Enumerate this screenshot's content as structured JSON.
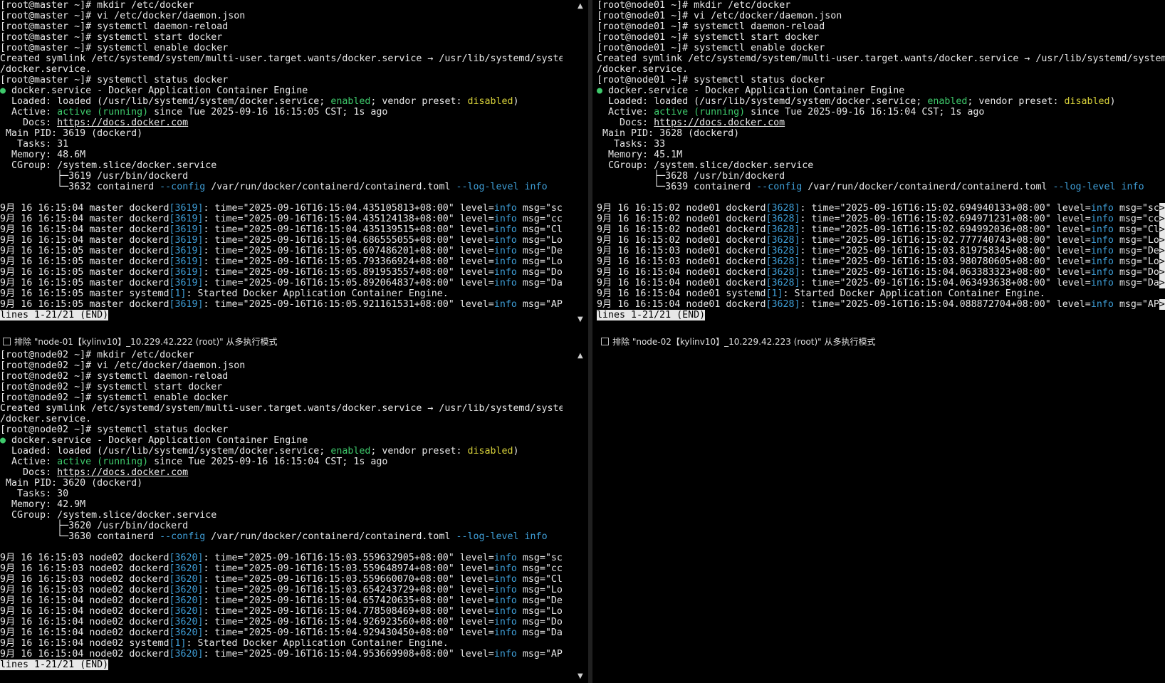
{
  "panes": [
    {
      "id": "master",
      "prompt": "[root@master ~]#",
      "cmds": [
        "mkdir /etc/docker",
        "vi /etc/docker/daemon.json",
        "systemctl daemon-reload",
        "systemctl start docker",
        "systemctl enable docker"
      ],
      "symlink1": "Created symlink /etc/systemd/system/multi-user.target.wants/docker.service → /usr/lib/systemd/system",
      "symlink2": "/docker.service.",
      "status_cmd": "systemctl status docker",
      "since": " since Tue 2025-09-16 16:15:05 CST; 1s ago",
      "pid": "3619 (dockerd)",
      "tasks": "31",
      "memory": "48.6M",
      "cg1": "3619 /usr/bin/dockerd",
      "cg2": "3632 containerd ",
      "log_pid": "[3619]",
      "host": "master",
      "logs": [
        [
          "9月 16 16:15:04",
          "2025-09-16T16:15:04.435105813+08:00",
          "sc"
        ],
        [
          "9月 16 16:15:04",
          "2025-09-16T16:15:04.435124138+08:00",
          "cc"
        ],
        [
          "9月 16 16:15:04",
          "2025-09-16T16:15:04.435139515+08:00",
          "Cl"
        ],
        [
          "9月 16 16:15:04",
          "2025-09-16T16:15:04.686555055+08:00",
          "Lo"
        ],
        [
          "9月 16 16:15:05",
          "2025-09-16T16:15:05.607486201+08:00",
          "De"
        ],
        [
          "9月 16 16:15:05",
          "2025-09-16T16:15:05.793366924+08:00",
          "Lo"
        ],
        [
          "9月 16 16:15:05",
          "2025-09-16T16:15:05.891953557+08:00",
          "Do"
        ],
        [
          "9月 16 16:15:05",
          "2025-09-16T16:15:05.892064837+08:00",
          "Da"
        ]
      ],
      "started_time": "9月 16 16:15:05",
      "last": [
        "9月 16 16:15:05",
        "2025-09-16T16:15:05.921161531+08:00",
        "AP"
      ],
      "exclude": "排除 \"node-01【kylinv10】_10.229.42.222 (root)\" 从多执行模式"
    },
    {
      "id": "node01",
      "prompt": "[root@node01 ~]#",
      "cmds": [
        "mkdir /etc/docker",
        "vi /etc/docker/daemon.json",
        "systemctl daemon-reload",
        "systemctl start docker",
        "systemctl enable docker"
      ],
      "symlink1": "Created symlink /etc/systemd/system/multi-user.target.wants/docker.service → /usr/lib/systemd/system",
      "symlink2": "/docker.service.",
      "status_cmd": "systemctl status docker",
      "since": " since Tue 2025-09-16 16:15:04 CST; 1s ago",
      "pid": "3628 (dockerd)",
      "tasks": "33",
      "memory": "45.1M",
      "cg1": "3628 /usr/bin/dockerd",
      "cg2": "3639 containerd ",
      "log_pid": "[3628]",
      "host": "node01",
      "logs": [
        [
          "9月 16 16:15:02",
          "2025-09-16T16:15:02.694940133+08:00",
          "sc"
        ],
        [
          "9月 16 16:15:02",
          "2025-09-16T16:15:02.694971231+08:00",
          "cc"
        ],
        [
          "9月 16 16:15:02",
          "2025-09-16T16:15:02.694992036+08:00",
          "Cl"
        ],
        [
          "9月 16 16:15:02",
          "2025-09-16T16:15:02.777740743+08:00",
          "Lo"
        ],
        [
          "9月 16 16:15:03",
          "2025-09-16T16:15:03.819758345+08:00",
          "De"
        ],
        [
          "9月 16 16:15:03",
          "2025-09-16T16:15:03.980780605+08:00",
          "Lo"
        ],
        [
          "9月 16 16:15:04",
          "2025-09-16T16:15:04.063383323+08:00",
          "Do"
        ],
        [
          "9月 16 16:15:04",
          "2025-09-16T16:15:04.063493638+08:00",
          "Da"
        ]
      ],
      "started_time": "9月 16 16:15:04",
      "last": [
        "9月 16 16:15:04",
        "2025-09-16T16:15:04.088872704+08:00",
        "AP"
      ],
      "exclude": "排除 \"node-02【kylinv10】_10.229.42.223 (root)\" 从多执行模式"
    },
    {
      "id": "node02",
      "prompt": "[root@node02 ~]#",
      "cmds": [
        "mkdir /etc/docker",
        "vi /etc/docker/daemon.json",
        "systemctl daemon-reload",
        "systemctl start docker",
        "systemctl enable docker"
      ],
      "symlink1": "Created symlink /etc/systemd/system/multi-user.target.wants/docker.service → /usr/lib/systemd/system",
      "symlink2": "/docker.service.",
      "status_cmd": "systemctl status docker",
      "since": " since Tue 2025-09-16 16:15:04 CST; 1s ago",
      "pid": "3620 (dockerd)",
      "tasks": "30",
      "memory": "42.9M",
      "cg1": "3620 /usr/bin/dockerd",
      "cg2": "3630 containerd ",
      "log_pid": "[3620]",
      "host": "node02",
      "logs": [
        [
          "9月 16 16:15:03",
          "2025-09-16T16:15:03.559632905+08:00",
          "sc"
        ],
        [
          "9月 16 16:15:03",
          "2025-09-16T16:15:03.559648974+08:00",
          "cc"
        ],
        [
          "9月 16 16:15:03",
          "2025-09-16T16:15:03.559660070+08:00",
          "Cl"
        ],
        [
          "9月 16 16:15:03",
          "2025-09-16T16:15:03.654243729+08:00",
          "Lo"
        ],
        [
          "9月 16 16:15:04",
          "2025-09-16T16:15:04.657420635+08:00",
          "De"
        ],
        [
          "9月 16 16:15:04",
          "2025-09-16T16:15:04.778508469+08:00",
          "Lo"
        ],
        [
          "9月 16 16:15:04",
          "2025-09-16T16:15:04.926923560+08:00",
          "Do"
        ],
        [
          "9月 16 16:15:04",
          "2025-09-16T16:15:04.929430450+08:00",
          "Da"
        ]
      ],
      "started_time": "9月 16 16:15:04",
      "last": [
        "9月 16 16:15:04",
        "2025-09-16T16:15:04.953669908+08:00",
        "AP"
      ],
      "exclude": ""
    }
  ],
  "common": {
    "service_line": " docker.service - Docker Application Container Engine",
    "bullet": "●",
    "loaded_label": "  Loaded: ",
    "loaded_pre": "loaded (/usr/lib/systemd/system/docker.service; ",
    "enabled": "enabled",
    "loaded_mid": "; vendor preset: ",
    "disabled": "disabled",
    "loaded_end": ")",
    "active_label": "  Active: ",
    "active_val": "active (running)",
    "docs_label": "    Docs: ",
    "docs_url": "https://docs.docker.com",
    "pid_label": " Main PID: ",
    "tasks_label": "   Tasks: ",
    "memory_label": "  Memory: ",
    "cgroup_label": "  CGroup: ",
    "cgroup_val": "/system.slice/docker.service",
    "cg_branch1": "          ├─",
    "cg_branch2": "          └─",
    "config_flag": "--config",
    "config_path": " /var/run/docker/containerd/containerd.toml ",
    "loglevel_flag": "--log-level",
    "info": "info",
    "dockerd": " dockerd",
    "time_pre": ": time=\"",
    "level_pre": "\" level=",
    "msg_pre": " msg=\"",
    "systemd": " systemd",
    "systemd_pid": "[1]",
    "started": ": Started Docker Application Container Engine.",
    "status_bar": "lines 1-21/21 (END)",
    "cursor": ">",
    "scroll_up": "▲",
    "scroll_down": "▼"
  }
}
